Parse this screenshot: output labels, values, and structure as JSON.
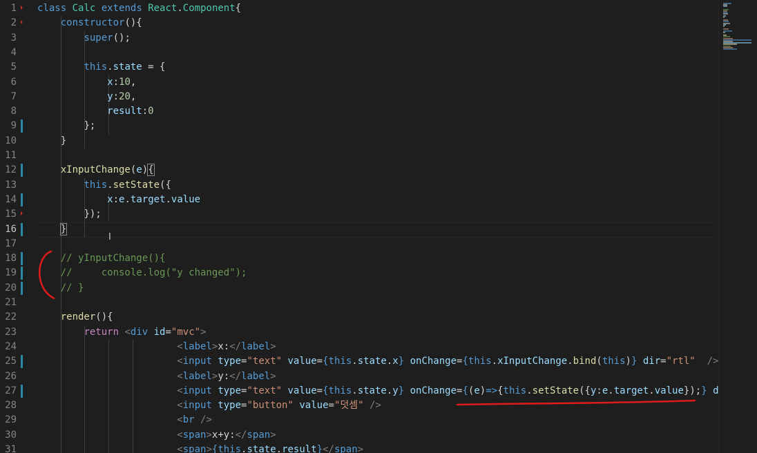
{
  "editor": {
    "active_line": 16,
    "lines": [
      {
        "n": "1",
        "tokens": [
          [
            "class",
            "kw"
          ],
          [
            " ",
            ""
          ],
          [
            "Calc",
            "cls"
          ],
          [
            " ",
            ""
          ],
          [
            "extends",
            "kw"
          ],
          [
            " ",
            ""
          ],
          [
            "React",
            "cls"
          ],
          [
            ".",
            ""
          ],
          [
            "Component",
            "cls"
          ],
          [
            "{",
            ""
          ]
        ]
      },
      {
        "n": "2",
        "tokens": [
          [
            "    ",
            ""
          ],
          [
            "constructor",
            "kw"
          ],
          [
            "(){",
            ""
          ]
        ]
      },
      {
        "n": "3",
        "tokens": [
          [
            "        ",
            ""
          ],
          [
            "super",
            "kw"
          ],
          [
            "();",
            ""
          ]
        ]
      },
      {
        "n": "4",
        "tokens": []
      },
      {
        "n": "5",
        "tokens": [
          [
            "        ",
            ""
          ],
          [
            "this",
            "kw"
          ],
          [
            ".",
            ""
          ],
          [
            "state",
            "var"
          ],
          [
            " = {",
            ""
          ]
        ]
      },
      {
        "n": "6",
        "tokens": [
          [
            "            ",
            ""
          ],
          [
            "x",
            "var"
          ],
          [
            ":",
            ""
          ],
          [
            "10",
            "num"
          ],
          [
            ",",
            ""
          ]
        ]
      },
      {
        "n": "7",
        "tokens": [
          [
            "            ",
            ""
          ],
          [
            "y",
            "var"
          ],
          [
            ":",
            ""
          ],
          [
            "20",
            "num"
          ],
          [
            ",",
            ""
          ]
        ]
      },
      {
        "n": "8",
        "tokens": [
          [
            "            ",
            ""
          ],
          [
            "result",
            "var"
          ],
          [
            ":",
            ""
          ],
          [
            "0",
            "num"
          ]
        ]
      },
      {
        "n": "9",
        "tokens": [
          [
            "        ",
            ""
          ],
          [
            "};",
            ""
          ]
        ]
      },
      {
        "n": "10",
        "tokens": [
          [
            "    ",
            ""
          ],
          [
            "}",
            ""
          ]
        ]
      },
      {
        "n": "11",
        "tokens": []
      },
      {
        "n": "12",
        "tokens": [
          [
            "    ",
            ""
          ],
          [
            "xInputChange",
            "fn"
          ],
          [
            "(",
            ""
          ],
          [
            "e",
            "var"
          ],
          [
            ")",
            ""
          ],
          [
            "{",
            "brk"
          ]
        ]
      },
      {
        "n": "13",
        "tokens": [
          [
            "        ",
            ""
          ],
          [
            "this",
            "kw"
          ],
          [
            ".",
            ""
          ],
          [
            "setState",
            "fn"
          ],
          [
            "({",
            ""
          ]
        ]
      },
      {
        "n": "14",
        "tokens": [
          [
            "            ",
            ""
          ],
          [
            "x",
            "var"
          ],
          [
            ":",
            ""
          ],
          [
            "e",
            "var"
          ],
          [
            ".",
            ""
          ],
          [
            "target",
            "var"
          ],
          [
            ".",
            ""
          ],
          [
            "value",
            "var"
          ]
        ]
      },
      {
        "n": "15",
        "tokens": [
          [
            "        ",
            ""
          ],
          [
            "});",
            ""
          ]
        ]
      },
      {
        "n": "16",
        "tokens": [
          [
            "    ",
            ""
          ],
          [
            "}",
            "brk"
          ]
        ]
      },
      {
        "n": "17",
        "tokens": []
      },
      {
        "n": "18",
        "tokens": [
          [
            "    ",
            ""
          ],
          [
            "// yInputChange(){",
            "cmt"
          ]
        ]
      },
      {
        "n": "19",
        "tokens": [
          [
            "    ",
            ""
          ],
          [
            "//     console.log(\"y changed\");",
            "cmt"
          ]
        ]
      },
      {
        "n": "20",
        "tokens": [
          [
            "    ",
            ""
          ],
          [
            "// }",
            "cmt"
          ]
        ]
      },
      {
        "n": "21",
        "tokens": []
      },
      {
        "n": "22",
        "tokens": [
          [
            "    ",
            ""
          ],
          [
            "render",
            "fn"
          ],
          [
            "(){",
            ""
          ]
        ]
      },
      {
        "n": "23",
        "tokens": [
          [
            "        ",
            ""
          ],
          [
            "return",
            "ctl"
          ],
          [
            " ",
            ""
          ],
          [
            "<",
            "ang"
          ],
          [
            "div",
            "tag"
          ],
          [
            " ",
            ""
          ],
          [
            "id",
            "attr"
          ],
          [
            "=",
            ""
          ],
          [
            "\"mvc\"",
            "str"
          ],
          [
            ">",
            "ang"
          ]
        ]
      },
      {
        "n": "24",
        "tokens": [
          [
            "                        ",
            ""
          ],
          [
            "<",
            "ang"
          ],
          [
            "label",
            "tag"
          ],
          [
            ">",
            "ang"
          ],
          [
            "x:",
            ""
          ],
          [
            "</",
            "ang"
          ],
          [
            "label",
            "tag"
          ],
          [
            ">",
            "ang"
          ]
        ]
      },
      {
        "n": "25",
        "tokens": [
          [
            "                        ",
            ""
          ],
          [
            "<",
            "ang"
          ],
          [
            "input",
            "tag"
          ],
          [
            " ",
            ""
          ],
          [
            "type",
            "attr"
          ],
          [
            "=",
            ""
          ],
          [
            "\"text\"",
            "str"
          ],
          [
            " ",
            ""
          ],
          [
            "value",
            "attr"
          ],
          [
            "=",
            ""
          ],
          [
            "{",
            "kw"
          ],
          [
            "this",
            "kw"
          ],
          [
            ".",
            ""
          ],
          [
            "state",
            "var"
          ],
          [
            ".",
            ""
          ],
          [
            "x",
            "var"
          ],
          [
            "}",
            "kw"
          ],
          [
            " ",
            ""
          ],
          [
            "onChange",
            "attr"
          ],
          [
            "=",
            ""
          ],
          [
            "{",
            "kw"
          ],
          [
            "this",
            "kw"
          ],
          [
            ".",
            ""
          ],
          [
            "xInputChange",
            "var"
          ],
          [
            ".",
            ""
          ],
          [
            "bind",
            "fn"
          ],
          [
            "(",
            ""
          ],
          [
            "this",
            "kw"
          ],
          [
            ")",
            ""
          ],
          [
            "}",
            "kw"
          ],
          [
            " ",
            ""
          ],
          [
            "dir",
            "attr"
          ],
          [
            "=",
            ""
          ],
          [
            "\"rtl\"",
            "str"
          ],
          [
            "  ",
            ""
          ],
          [
            "/>",
            "ang"
          ]
        ]
      },
      {
        "n": "26",
        "tokens": [
          [
            "                        ",
            ""
          ],
          [
            "<",
            "ang"
          ],
          [
            "label",
            "tag"
          ],
          [
            ">",
            "ang"
          ],
          [
            "y:",
            ""
          ],
          [
            "</",
            "ang"
          ],
          [
            "label",
            "tag"
          ],
          [
            ">",
            "ang"
          ]
        ]
      },
      {
        "n": "27",
        "tokens": [
          [
            "                        ",
            ""
          ],
          [
            "<",
            "ang"
          ],
          [
            "input",
            "tag"
          ],
          [
            " ",
            ""
          ],
          [
            "type",
            "attr"
          ],
          [
            "=",
            ""
          ],
          [
            "\"text\"",
            "str"
          ],
          [
            " ",
            ""
          ],
          [
            "value",
            "attr"
          ],
          [
            "=",
            ""
          ],
          [
            "{",
            "kw"
          ],
          [
            "this",
            "kw"
          ],
          [
            ".",
            ""
          ],
          [
            "state",
            "var"
          ],
          [
            ".",
            ""
          ],
          [
            "y",
            "var"
          ],
          [
            "}",
            "kw"
          ],
          [
            " ",
            ""
          ],
          [
            "onChange",
            "attr"
          ],
          [
            "=",
            ""
          ],
          [
            "{",
            "kw"
          ],
          [
            "(",
            ""
          ],
          [
            "e",
            "var"
          ],
          [
            ")",
            ""
          ],
          [
            "=>",
            "kw"
          ],
          [
            "{",
            ""
          ],
          [
            "this",
            "kw"
          ],
          [
            ".",
            ""
          ],
          [
            "setState",
            "fn"
          ],
          [
            "({",
            ""
          ],
          [
            "y",
            "var"
          ],
          [
            ":",
            ""
          ],
          [
            "e",
            "var"
          ],
          [
            ".",
            ""
          ],
          [
            "target",
            "var"
          ],
          [
            ".",
            ""
          ],
          [
            "value",
            "var"
          ],
          [
            "});",
            ""
          ],
          [
            "}",
            "kw"
          ],
          [
            " ",
            ""
          ],
          [
            "di",
            "attr"
          ]
        ]
      },
      {
        "n": "28",
        "tokens": [
          [
            "                        ",
            ""
          ],
          [
            "<",
            "ang"
          ],
          [
            "input",
            "tag"
          ],
          [
            " ",
            ""
          ],
          [
            "type",
            "attr"
          ],
          [
            "=",
            ""
          ],
          [
            "\"button\"",
            "str"
          ],
          [
            " ",
            ""
          ],
          [
            "value",
            "attr"
          ],
          [
            "=",
            ""
          ],
          [
            "\"덧셈\"",
            "str"
          ],
          [
            " ",
            ""
          ],
          [
            "/>",
            "ang"
          ]
        ]
      },
      {
        "n": "29",
        "tokens": [
          [
            "                        ",
            ""
          ],
          [
            "<",
            "ang"
          ],
          [
            "br",
            "tag"
          ],
          [
            " ",
            ""
          ],
          [
            "/>",
            "ang"
          ]
        ]
      },
      {
        "n": "30",
        "tokens": [
          [
            "                        ",
            ""
          ],
          [
            "<",
            "ang"
          ],
          [
            "span",
            "tag"
          ],
          [
            ">",
            "ang"
          ],
          [
            "x+y:",
            ""
          ],
          [
            "</",
            "ang"
          ],
          [
            "span",
            "tag"
          ],
          [
            ">",
            "ang"
          ]
        ]
      },
      {
        "n": "31",
        "tokens": [
          [
            "                        ",
            ""
          ],
          [
            "<",
            "ang"
          ],
          [
            "span",
            "tag"
          ],
          [
            ">",
            "ang"
          ],
          [
            "{",
            "kw"
          ],
          [
            "this",
            "kw"
          ],
          [
            ".",
            ""
          ],
          [
            "state",
            "var"
          ],
          [
            ".",
            ""
          ],
          [
            "result",
            "var"
          ],
          [
            "}",
            "kw"
          ],
          [
            "</",
            "ang"
          ],
          [
            "span",
            "tag"
          ],
          [
            ">",
            "ang"
          ]
        ]
      }
    ]
  },
  "colors": {
    "background": "#1e1e1e",
    "keyword": "#569cd6",
    "class": "#4ec9b0",
    "function": "#dcdcaa",
    "variable": "#9cdcfe",
    "number": "#b5cea8",
    "string": "#ce9178",
    "comment": "#6a9955",
    "control": "#c586c0",
    "annotation": "#e01b1b",
    "modified_marker": "#2a8aa5"
  }
}
